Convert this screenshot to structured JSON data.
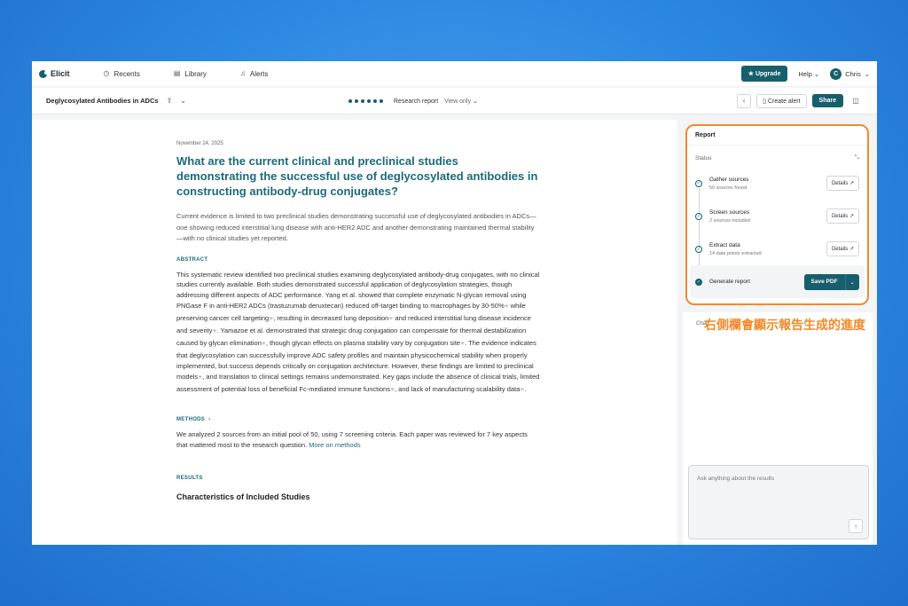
{
  "nav": {
    "brand": "Elicit",
    "items": [
      {
        "label": "Recents",
        "icon": "clock-icon"
      },
      {
        "label": "Library",
        "icon": "book-icon"
      },
      {
        "label": "Alerts",
        "icon": "bell-icon"
      }
    ],
    "upgrade": "Upgrade",
    "help": "Help",
    "user_initial": "C",
    "user_name": "Chris"
  },
  "toolbar": {
    "doc_title": "Deglycosylated Antibodies in ADCs",
    "report_type": "Research report",
    "view_mode": "View only",
    "create_alert": "Create alert",
    "share": "Share"
  },
  "article": {
    "date": "November 24, 2025",
    "question": "What are the current clinical and preclinical studies demonstrating the successful use of deglycosylated antibodies in constructing antibody-drug conjugates?",
    "summary": "Current evidence is limited to two preclinical studies demonstrating successful use of deglycosylated antibodies in ADCs—one showing reduced interstitial lung disease with anti-HER2 ADC and another demonstrating maintained thermal stability—with no clinical studies yet reported.",
    "abstract_label": "ABSTRACT",
    "abstract": [
      "This systematic review identified two preclinical studies examining deglycosylated antibody-drug conjugates, with no clinical studies currently available. Both studies demonstrated successful application of deglycosylation strategies, though addressing different aspects of ADC performance. Yang et al. showed that complete enzymatic N-glycan removal using PNGase F in anti-HER2 ADCs (trastuzumab deruxtecan) reduced off-target binding to macrophages by 30-50%",
      " while preserving cancer cell targeting",
      ", resulting in decreased lung deposition",
      " and reduced interstitial lung disease incidence and severity",
      ". Yamazoe et al. demonstrated that strategic drug conjugation can compensate for thermal destabilization caused by glycan elimination",
      ", though glycan effects on plasma stability vary by conjugation site",
      ". The evidence indicates that deglycosylation can successfully improve ADC safety profiles and maintain physicochemical stability when properly implemented, but success depends critically on conjugation architecture. However, these findings are limited to preclinical models",
      ", and translation to clinical settings remains undemonstrated. Key gaps include the absence of clinical trials, limited assessment of potential loss of beneficial Fc-mediated immune functions",
      ", and lack of manufacturing scalability data",
      "."
    ],
    "methods_label": "METHODS",
    "methods": "We analyzed 2 sources from an initial pool of 50, using 7 screening criteria. Each paper was reviewed for 7 key aspects that mattered most to the research question.",
    "methods_link": "More on methods",
    "results_label": "RESULTS",
    "results_heading": "Characteristics of Included Studies"
  },
  "report_panel": {
    "title": "Report",
    "status_label": "Status",
    "steps": [
      {
        "title": "Gather sources",
        "detail": "50 sources found",
        "button": "Details"
      },
      {
        "title": "Screen sources",
        "detail": "2 sources included",
        "button": "Details"
      },
      {
        "title": "Extract data",
        "detail": "14 data points extracted",
        "button": "Details"
      },
      {
        "title": "Generate report",
        "button": "Save PDF"
      }
    ]
  },
  "chat": {
    "label": "Chat",
    "placeholder": "Ask anything about the results"
  },
  "annotation": {
    "text": "右側欄會顯示報告生成的進度"
  },
  "colors": {
    "teal": "#175f6c",
    "highlight": "#f18a2a"
  }
}
